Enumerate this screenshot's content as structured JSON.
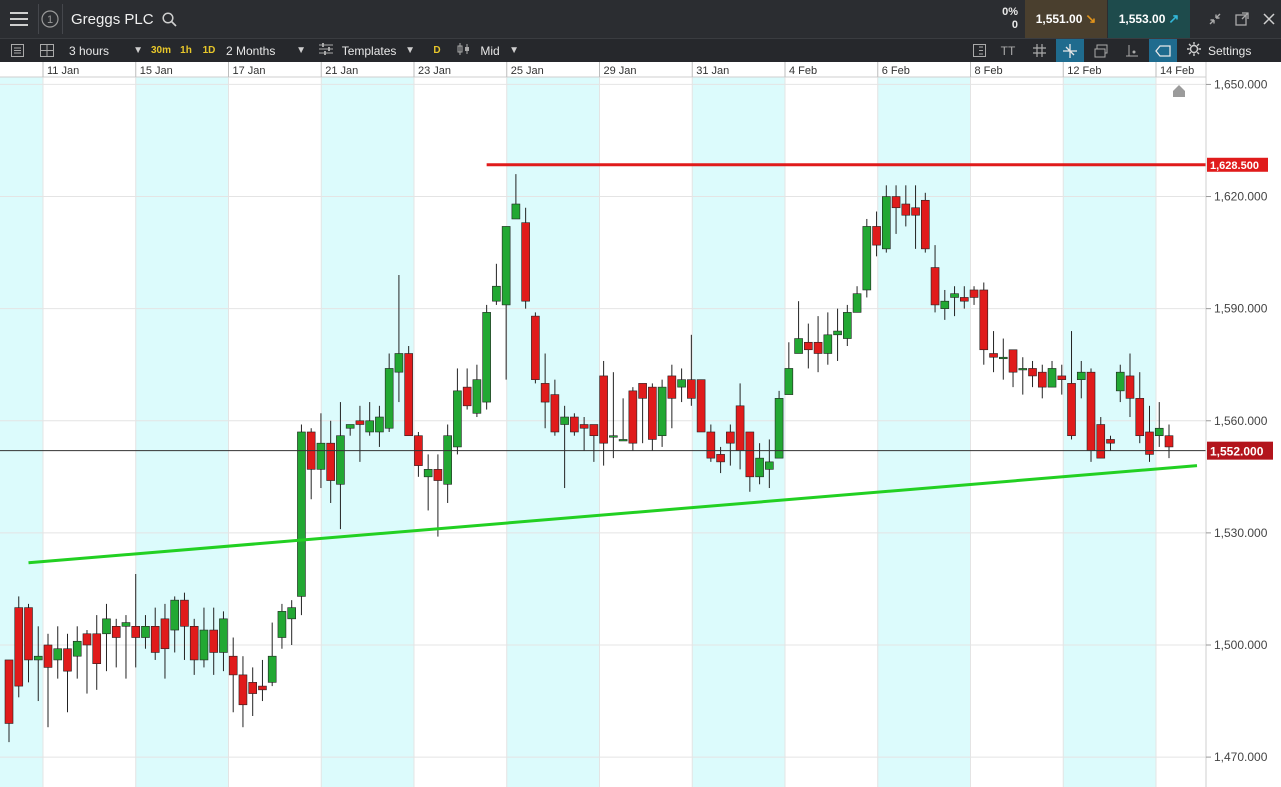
{
  "header": {
    "title": "Greggs PLC",
    "info_number": "1",
    "spread_pct": "0%",
    "spread_val": "0",
    "sell_price": "1,551.00",
    "buy_price": "1,553.00"
  },
  "toolbar": {
    "interval": "3 hours",
    "quick_30m": "30m",
    "quick_1h": "1h",
    "quick_1d": "1D",
    "range": "2 Months",
    "templates": "Templates",
    "d_label": "D",
    "price_mode": "Mid",
    "text_tool": "TT",
    "settings": "Settings"
  },
  "colors": {
    "up": "#22a833",
    "down": "#e01b1b",
    "band": "#dcfbfc",
    "support": "#22d022",
    "resistance": "#e01b1b"
  },
  "chart_data": {
    "type": "candlestick",
    "ylim": [
      1462,
      1656
    ],
    "yticks": [
      1650,
      1620,
      1590,
      1560,
      1530,
      1500,
      1470
    ],
    "ytick_labels": [
      "1,650.000",
      "1,620.000",
      "1,590.000",
      "1,560.000",
      "1,530.000",
      "1,500.000",
      "1,470.000"
    ],
    "x_dates": [
      "11 Jan",
      "15 Jan",
      "17 Jan",
      "21 Jan",
      "23 Jan",
      "25 Jan",
      "29 Jan",
      "31 Jan",
      "4 Feb",
      "6 Feb",
      "8 Feb",
      "12 Feb",
      "14 Feb"
    ],
    "current_price": 1552.0,
    "current_price_label": "1,552.000",
    "resistance_level": 1628.5,
    "resistance_label": "1,628.500",
    "support_line": {
      "from": 1522,
      "to": 1548
    },
    "candles": [
      [
        1496,
        1479,
        1493,
        1474
      ],
      [
        1510,
        1489,
        1513,
        1486
      ],
      [
        1510,
        1496,
        1511,
        1490
      ],
      [
        1496,
        1497,
        1505,
        1485
      ],
      [
        1500,
        1494,
        1503,
        1478
      ],
      [
        1496,
        1499,
        1505,
        1491
      ],
      [
        1499,
        1493,
        1503,
        1482
      ],
      [
        1497,
        1501,
        1505,
        1491
      ],
      [
        1503,
        1500,
        1504,
        1487
      ],
      [
        1503,
        1495,
        1508,
        1488
      ],
      [
        1503,
        1507,
        1511,
        1493
      ],
      [
        1505,
        1502,
        1507,
        1494
      ],
      [
        1505,
        1506,
        1508,
        1491
      ],
      [
        1505,
        1502,
        1519,
        1494
      ],
      [
        1502,
        1505,
        1508,
        1499
      ],
      [
        1505,
        1498,
        1510,
        1496
      ],
      [
        1507,
        1499,
        1511,
        1491
      ],
      [
        1504,
        1512,
        1513,
        1498
      ],
      [
        1512,
        1505,
        1514,
        1496
      ],
      [
        1505,
        1496,
        1507,
        1492
      ],
      [
        1496,
        1504,
        1510,
        1494
      ],
      [
        1504,
        1498,
        1510,
        1492
      ],
      [
        1498,
        1507,
        1509,
        1493
      ],
      [
        1497,
        1492,
        1502,
        1482
      ],
      [
        1492,
        1484,
        1497,
        1478
      ],
      [
        1490,
        1487,
        1494,
        1481
      ],
      [
        1489,
        1488,
        1496,
        1485
      ],
      [
        1490,
        1497,
        1506,
        1489
      ],
      [
        1502,
        1509,
        1511,
        1499
      ],
      [
        1507,
        1510,
        1512,
        1500
      ],
      [
        1513,
        1557,
        1559,
        1508
      ],
      [
        1557,
        1547,
        1558,
        1539
      ],
      [
        1547,
        1554,
        1562,
        1542
      ],
      [
        1554,
        1544,
        1560,
        1538
      ],
      [
        1543,
        1556,
        1565,
        1531
      ],
      [
        1558,
        1559,
        1559,
        1556
      ],
      [
        1560,
        1559,
        1564,
        1549
      ],
      [
        1557,
        1560,
        1565,
        1556
      ],
      [
        1557,
        1561,
        1564,
        1553
      ],
      [
        1558,
        1574,
        1578,
        1557
      ],
      [
        1573,
        1578,
        1599,
        1565
      ],
      [
        1578,
        1556,
        1580,
        1556
      ],
      [
        1556,
        1548,
        1557,
        1545
      ],
      [
        1545,
        1547,
        1551,
        1536
      ],
      [
        1547,
        1544,
        1551,
        1529
      ],
      [
        1543,
        1556,
        1559,
        1538
      ],
      [
        1553,
        1568,
        1574,
        1551
      ],
      [
        1569,
        1564,
        1574,
        1563
      ],
      [
        1562,
        1571,
        1575,
        1561
      ],
      [
        1565,
        1589,
        1591,
        1563
      ],
      [
        1592,
        1596,
        1602,
        1591
      ],
      [
        1591,
        1612,
        1612,
        1571
      ],
      [
        1614,
        1618,
        1626,
        1614
      ],
      [
        1613,
        1592,
        1617,
        1590
      ],
      [
        1588,
        1571,
        1589,
        1570
      ],
      [
        1570,
        1565,
        1578,
        1558
      ],
      [
        1567,
        1557,
        1571,
        1556
      ],
      [
        1559,
        1561,
        1564,
        1542
      ],
      [
        1561,
        1557,
        1562,
        1556
      ],
      [
        1559,
        1558,
        1561,
        1552
      ],
      [
        1559,
        1556,
        1559,
        1549
      ],
      [
        1572,
        1554,
        1576,
        1548
      ],
      [
        1556,
        1556,
        1573,
        1550
      ],
      [
        1555,
        1555,
        1566,
        1555
      ],
      [
        1568,
        1554,
        1569,
        1552
      ],
      [
        1570,
        1566,
        1570,
        1554
      ],
      [
        1569,
        1555,
        1570,
        1552
      ],
      [
        1556,
        1569,
        1571,
        1553
      ],
      [
        1572,
        1566,
        1575,
        1558
      ],
      [
        1569,
        1571,
        1574,
        1565
      ],
      [
        1571,
        1566,
        1583,
        1564
      ],
      [
        1571,
        1557,
        1571,
        1557
      ],
      [
        1557,
        1550,
        1559,
        1549
      ],
      [
        1551,
        1549,
        1553,
        1546
      ],
      [
        1557,
        1554,
        1559,
        1548
      ],
      [
        1564,
        1552,
        1570,
        1547
      ],
      [
        1557,
        1545,
        1557,
        1541
      ],
      [
        1545,
        1550,
        1554,
        1543
      ],
      [
        1547,
        1549,
        1555,
        1542
      ],
      [
        1550,
        1566,
        1568,
        1551
      ],
      [
        1567,
        1574,
        1581,
        1567
      ],
      [
        1578,
        1582,
        1592,
        1578
      ],
      [
        1581,
        1579,
        1586,
        1574
      ],
      [
        1581,
        1578,
        1588,
        1573
      ],
      [
        1578,
        1583,
        1589,
        1575
      ],
      [
        1583,
        1584,
        1590,
        1576
      ],
      [
        1582,
        1589,
        1591,
        1580
      ],
      [
        1589,
        1594,
        1596,
        1589
      ],
      [
        1595,
        1612,
        1614,
        1593
      ],
      [
        1612,
        1607,
        1616,
        1604
      ],
      [
        1606,
        1620,
        1623,
        1605
      ],
      [
        1620,
        1617,
        1623,
        1610
      ],
      [
        1618,
        1615,
        1623,
        1612
      ],
      [
        1617,
        1615,
        1623,
        1606
      ],
      [
        1619,
        1606,
        1621,
        1605
      ],
      [
        1601,
        1591,
        1607,
        1589
      ],
      [
        1590,
        1592,
        1595,
        1587
      ],
      [
        1593,
        1594,
        1596,
        1588
      ],
      [
        1593,
        1592,
        1596,
        1590
      ],
      [
        1595,
        1593,
        1596,
        1591
      ],
      [
        1595,
        1579,
        1597,
        1575
      ],
      [
        1578,
        1577,
        1584,
        1573
      ],
      [
        1577,
        1577,
        1582,
        1571
      ],
      [
        1579,
        1573,
        1579,
        1569
      ],
      [
        1574,
        1574,
        1577,
        1567
      ],
      [
        1574,
        1572,
        1576,
        1569
      ],
      [
        1573,
        1569,
        1575,
        1566
      ],
      [
        1569,
        1574,
        1576,
        1569
      ],
      [
        1572,
        1571,
        1575,
        1567
      ],
      [
        1570,
        1556,
        1584,
        1555
      ],
      [
        1571,
        1573,
        1576,
        1566
      ],
      [
        1573,
        1552,
        1574,
        1549
      ],
      [
        1559,
        1550,
        1561,
        1550
      ],
      [
        1555,
        1554,
        1556,
        1552
      ],
      [
        1568,
        1573,
        1575,
        1565
      ],
      [
        1572,
        1566,
        1578,
        1561
      ],
      [
        1566,
        1556,
        1573,
        1554
      ],
      [
        1557,
        1551,
        1564,
        1549
      ],
      [
        1556,
        1558,
        1565,
        1553
      ],
      [
        1556,
        1553,
        1559,
        1550
      ]
    ]
  }
}
